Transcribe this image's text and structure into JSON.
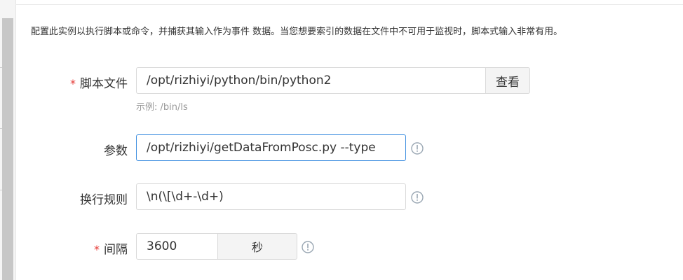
{
  "description": "配置此实例以执行脚本或命令，并捕获其输入作为事件 数据。当您想要索引的数据在文件中不可用于监视时，脚本式输入非常有用。",
  "form": {
    "script_file": {
      "required_mark": "*",
      "label": "脚本文件",
      "value": "/opt/rizhiyi/python/bin/python2",
      "button_label": "查看",
      "hint": "示例: /bin/ls"
    },
    "params": {
      "label": "参数",
      "value": "/opt/rizhiyi/getDataFromPosc.py --type",
      "info_icon": "info-circle-icon"
    },
    "line_break_rule": {
      "label": "换行规则",
      "value": "\\n(\\[\\d+-\\d+)",
      "info_icon": "info-circle-icon"
    },
    "interval": {
      "required_mark": "*",
      "label": "间隔",
      "value": "3600",
      "unit": "秒",
      "info_icon": "info-circle-icon"
    }
  },
  "colors": {
    "required": "#e53935",
    "focus_border": "#3f8fe0",
    "info_icon": "#9aa7b3",
    "hint_text": "#999999"
  }
}
